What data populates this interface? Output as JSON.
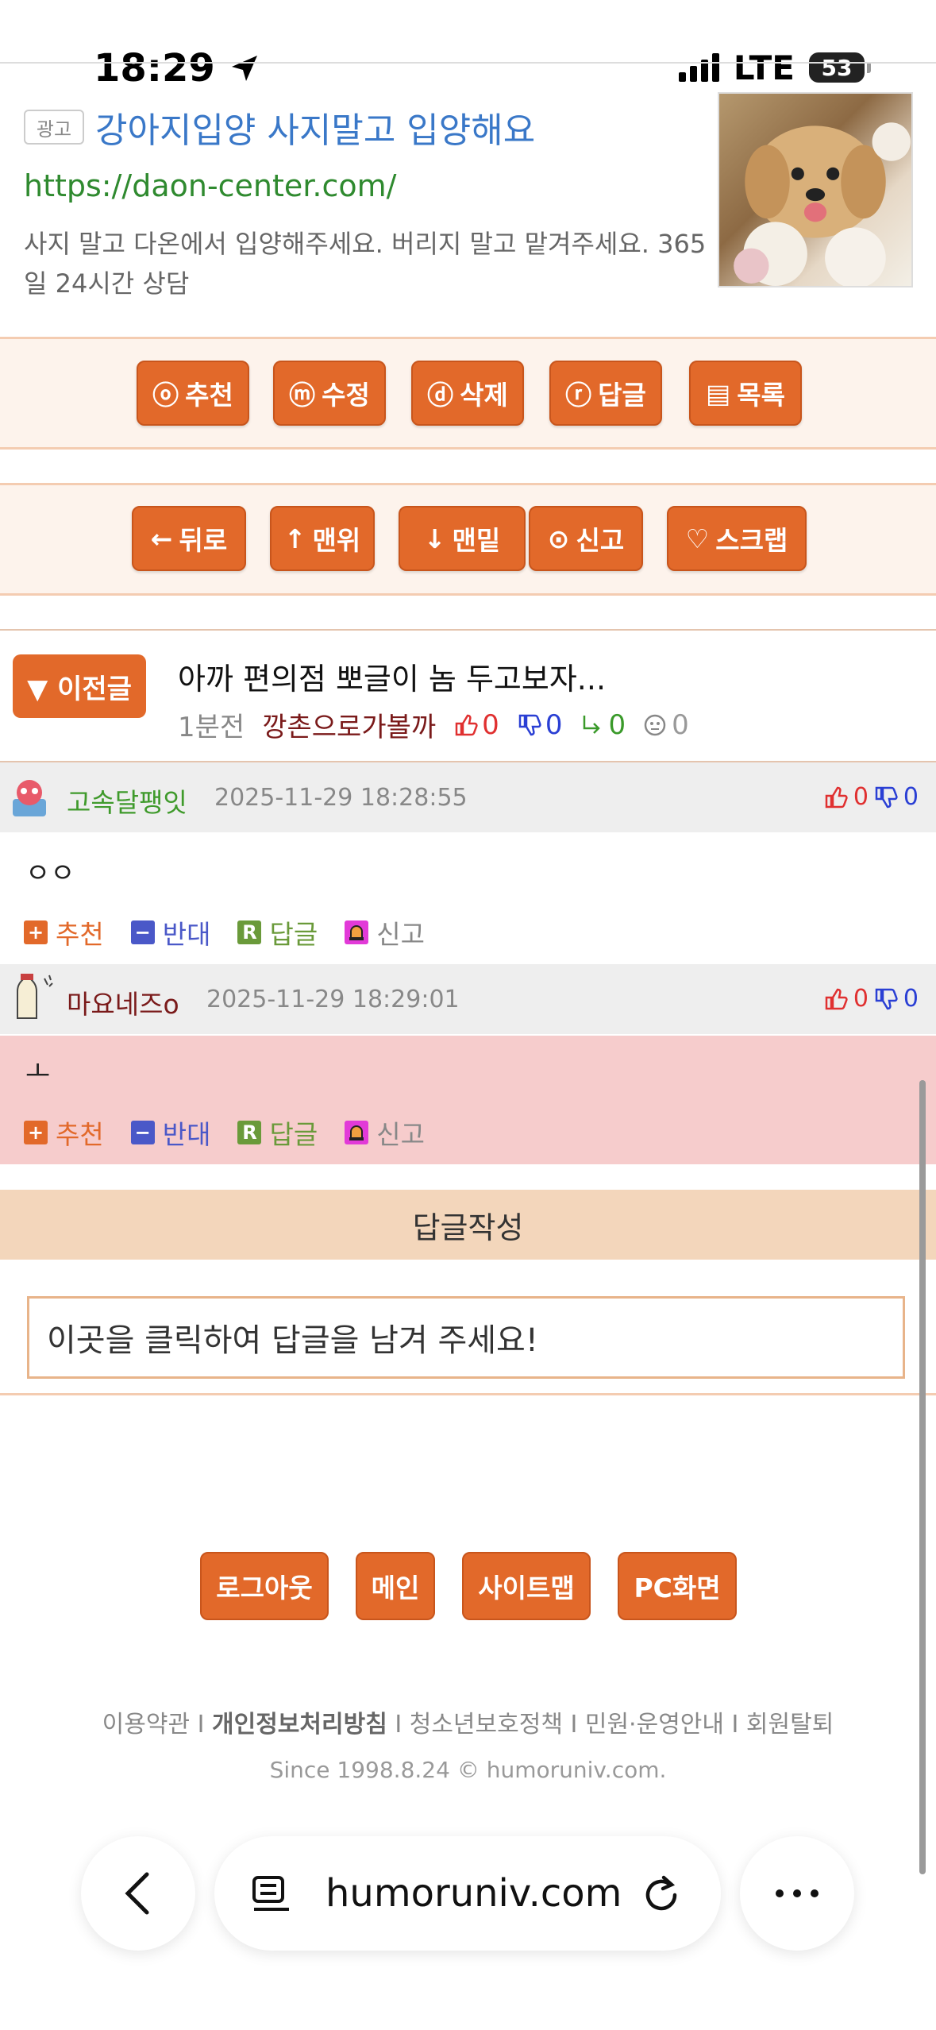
{
  "status": {
    "time": "18:29",
    "carrier": "LTE",
    "battery": "53"
  },
  "ad": {
    "badge": "광고",
    "title": "강아지입양 사지말고 입양해요",
    "url": "https://daon-center.com/",
    "description": "사지 말고 다온에서 입양해주세요. 버리지 말고 맡겨주세요. 365일 24시간 상담"
  },
  "toolbar1": [
    {
      "icon": "ⓞ",
      "label": "추천"
    },
    {
      "icon": "ⓜ",
      "label": "수정"
    },
    {
      "icon": "ⓓ",
      "label": "삭제"
    },
    {
      "icon": "ⓡ",
      "label": "답글"
    },
    {
      "icon": "▤",
      "label": "목록"
    }
  ],
  "toolbar2": [
    {
      "icon": "←",
      "label": "뒤로"
    },
    {
      "icon": "↑",
      "label": "맨위"
    },
    {
      "icon": "↓",
      "label": "맨밑"
    },
    {
      "icon": "⊙",
      "label": "신고"
    },
    {
      "icon": "♡",
      "label": "스크랩"
    }
  ],
  "prev_post": {
    "button": "▼ 이전글",
    "title": "아까 편의점 뽀글이 놈 두고보자...",
    "time": "1분전",
    "author": "깡촌으로가볼까",
    "up": "0",
    "down": "0",
    "replies": "0",
    "views": "0"
  },
  "comments": [
    {
      "name": "고속달팽잇",
      "date": "2025-11-29 18:28:55",
      "up": "0",
      "down": "0",
      "body": "ㅇㅇ",
      "name_color": "#3f9a2b"
    },
    {
      "name": "마요네즈o",
      "date": "2025-11-29 18:29:01",
      "up": "0",
      "down": "0",
      "body": "ㅗ",
      "name_color": "#7a1a1a"
    }
  ],
  "comment_actions": {
    "recommend": "추천",
    "oppose": "반대",
    "reply": "답글",
    "report": "신고"
  },
  "reply": {
    "header": "답글작성",
    "placeholder": "이곳을 클릭하여 답글을 남겨 주세요!"
  },
  "footer_buttons": [
    "로그아웃",
    "메인",
    "사이트맵",
    "PC화면"
  ],
  "footer_links": {
    "terms": "이용약관",
    "privacy": "개인정보처리방침",
    "youth": "청소년보호정책",
    "support": "민원·운영안내",
    "withdraw": "회원탈퇴"
  },
  "since": "Since 1998.8.24  © humoruniv.com.",
  "browser": {
    "domain": "humoruniv.com"
  },
  "colors": {
    "accent": "#e2692a",
    "up": "#e03030",
    "down": "#2a3fd4",
    "reply_count": "#3a9a2a"
  }
}
